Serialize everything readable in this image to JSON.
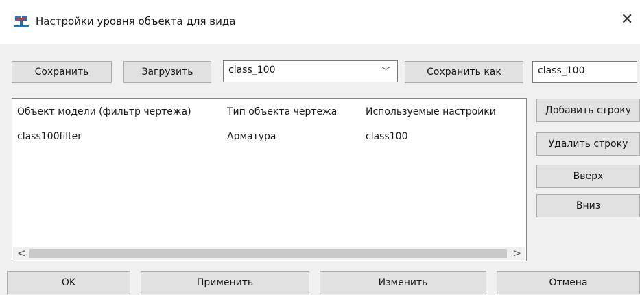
{
  "window": {
    "title": "Настройки уровня объекта для вида",
    "close_glyph": "✕",
    "icon": "app-icon"
  },
  "toolbar": {
    "save_label": "Сохранить",
    "load_label": "Загрузить",
    "preset_value": "class_100",
    "preset_arrow": "﹀",
    "save_as_label": "Сохранить как",
    "save_as_name": "class_100"
  },
  "table": {
    "columns": [
      "Объект модели (фильтр чертежа)",
      "Тип объекта чертежа",
      "Используемые настройки"
    ],
    "rows": [
      [
        "class100filter",
        "Арматура",
        "class100"
      ]
    ],
    "scroll_left": "<",
    "scroll_right": ">"
  },
  "side_buttons": {
    "add_row": "Добавить строку",
    "delete_row": "Удалить строку",
    "up": "Вверх",
    "down": "Вниз"
  },
  "footer": {
    "ok": "OK",
    "apply": "Применить",
    "modify": "Изменить",
    "cancel": "Отмена"
  },
  "colors": {
    "window_bg": "#f0f0f0",
    "button_bg": "#e1e1e1",
    "icon_blue": "#1b75c9",
    "icon_red": "#d0312d"
  }
}
